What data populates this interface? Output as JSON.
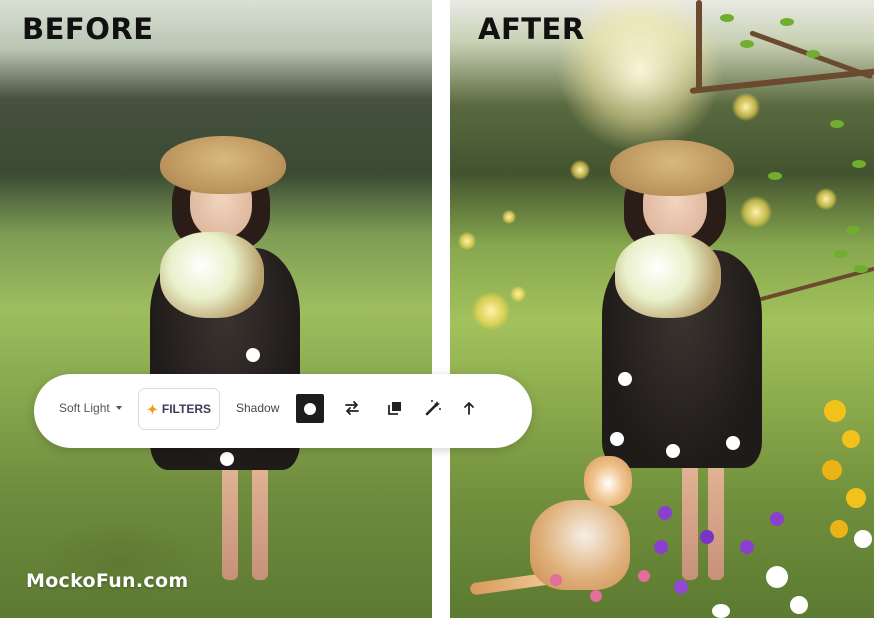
{
  "labels": {
    "before": "BEFORE",
    "after": "AFTER"
  },
  "watermark": "MockoFun.com",
  "toolbar": {
    "blend_mode": "Soft Light",
    "filters_label": "FILTERS",
    "shadow_label": "Shadow",
    "icons": [
      "circle-shape-icon",
      "swap-icon",
      "duplicate-icon",
      "magic-wand-icon",
      "arrow-up-icon"
    ]
  },
  "colors": {
    "toolbar_bg": "#ffffff",
    "accent_star": "#f29a13",
    "active_button": "#1d1d1f",
    "label_text": "#111111"
  }
}
